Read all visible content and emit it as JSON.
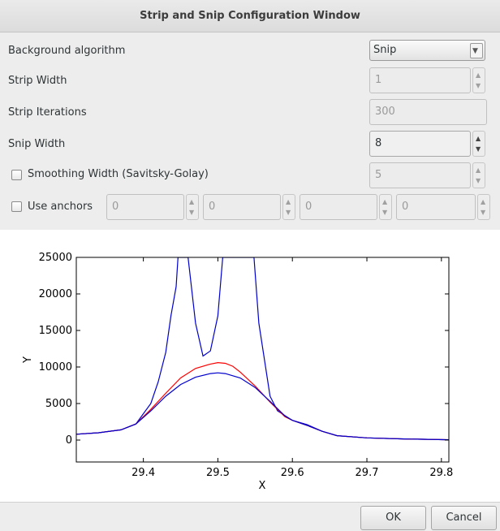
{
  "window": {
    "title": "Strip and Snip Configuration Window"
  },
  "form": {
    "background_algorithm": {
      "label": "Background algorithm",
      "value": "Snip"
    },
    "strip_width": {
      "label": "Strip Width",
      "value": "1"
    },
    "strip_iterations": {
      "label": "Strip Iterations",
      "value": "300"
    },
    "snip_width": {
      "label": "Snip Width",
      "value": "8"
    },
    "smoothing_width": {
      "label": "Smoothing Width (Savitsky-Golay)",
      "value": "5",
      "checked": false
    },
    "use_anchors": {
      "label": "Use anchors",
      "checked": false,
      "values": [
        "0",
        "0",
        "0",
        "0"
      ]
    }
  },
  "buttons": {
    "ok": "OK",
    "cancel": "Cancel"
  },
  "chart_data": {
    "type": "line",
    "title": "",
    "xlabel": "X",
    "ylabel": "Y",
    "xlim": [
      29.31,
      29.81
    ],
    "ylim": [
      -3000,
      25000
    ],
    "xticks": [
      "29.4",
      "29.5",
      "29.6",
      "29.7",
      "29.8"
    ],
    "xtick_values": [
      29.4,
      29.5,
      29.6,
      29.7,
      29.8
    ],
    "yticks": [
      "0",
      "5000",
      "10000",
      "15000",
      "20000",
      "25000"
    ],
    "ytick_values": [
      0,
      5000,
      10000,
      15000,
      20000,
      25000
    ],
    "series": [
      {
        "color": "#0000cc",
        "x": [
          29.31,
          29.34,
          29.37,
          29.39,
          29.41,
          29.42,
          29.43,
          29.437,
          29.444,
          29.4465,
          29.46,
          29.47,
          29.48,
          29.49,
          29.5,
          29.5065,
          29.5085,
          29.5465,
          29.5485,
          29.555,
          29.57,
          29.58,
          29.6,
          29.62,
          29.64,
          29.66,
          29.7,
          29.75,
          29.81
        ],
        "y": [
          800,
          1000,
          1400,
          2200,
          5000,
          8000,
          12000,
          17000,
          21000,
          25000,
          25000,
          16000,
          11500,
          12200,
          17000,
          25000,
          25000,
          25000,
          25000,
          16000,
          6000,
          4000,
          2700,
          2100,
          1200,
          600,
          300,
          150,
          50
        ]
      },
      {
        "color": "#ff0000",
        "x": [
          29.31,
          29.34,
          29.37,
          29.39,
          29.41,
          29.43,
          29.45,
          29.47,
          29.49,
          29.5,
          29.51,
          29.52,
          29.53,
          29.55,
          29.57,
          29.59,
          29.6,
          29.62,
          29.64,
          29.66,
          29.7,
          29.75,
          29.81
        ],
        "y": [
          800,
          1000,
          1400,
          2200,
          4200,
          6400,
          8500,
          9800,
          10400,
          10600,
          10500,
          10100,
          9300,
          7400,
          5200,
          3200,
          2700,
          2000,
          1200,
          600,
          300,
          150,
          50
        ]
      },
      {
        "color": "#0000cc",
        "x": [
          29.31,
          29.34,
          29.37,
          29.39,
          29.41,
          29.43,
          29.45,
          29.47,
          29.49,
          29.5,
          29.51,
          29.53,
          29.55,
          29.57,
          29.59,
          29.6,
          29.62,
          29.64,
          29.66,
          29.7,
          29.75,
          29.81
        ],
        "y": [
          800,
          1000,
          1400,
          2200,
          4000,
          6000,
          7600,
          8600,
          9100,
          9200,
          9100,
          8500,
          7200,
          5300,
          3300,
          2700,
          2000,
          1200,
          600,
          300,
          150,
          50
        ]
      }
    ]
  }
}
